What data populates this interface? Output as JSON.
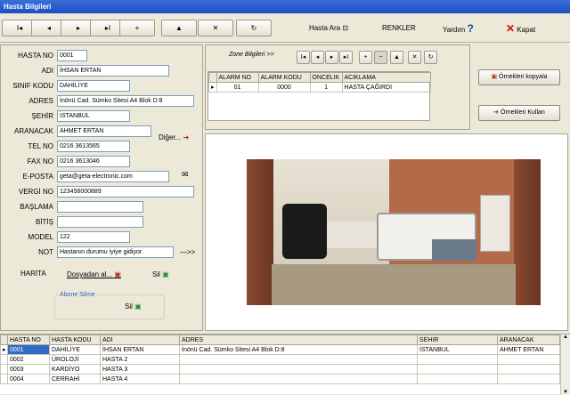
{
  "window": {
    "title": "Hasta Bilgileri"
  },
  "nav": {
    "first": "I◂",
    "prev": "◂",
    "next": "▸",
    "last": "▸I",
    "add": "+",
    "up": "▲",
    "delete": "✕",
    "refresh": "↻"
  },
  "toolbar": {
    "hasta_ara": "Hasta Ara",
    "renkler": "RENKLER",
    "yardim": "Yardım",
    "kapat": "Kapat"
  },
  "form": {
    "labels": {
      "hasta_no": "HASTA NO",
      "adi": "ADI",
      "sinif": "SINIF KODU",
      "adres": "ADRES",
      "sehir": "ŞEHİR",
      "aranacak": "ARANACAK",
      "tel": "TEL NO",
      "fax": "FAX NO",
      "eposta": "E-POSTA",
      "vergi": "VERGİ NO",
      "baslama": "BAŞLAMA",
      "bitis": "BİTİŞ",
      "model": "MODEL",
      "not": "NOT"
    },
    "values": {
      "hasta_no": "0001",
      "adi": "İHSAN ERTAN",
      "sinif": "DAHİLİYE",
      "adres": "İnönü Cad. Sümko Sitesi A4 Blok D:8",
      "sehir": "İSTANBUL",
      "aranacak": "AHMET ERTAN",
      "tel": "0216 3613565",
      "fax": "0216 3613046",
      "eposta": "geta@geta-electronic.com",
      "vergi": "123456000889",
      "baslama": "",
      "bitis": "",
      "model": "122",
      "not": "Hastanın durumu iyiye gidiyor."
    },
    "diger": "Diğer...",
    "not_arrow": "—>>",
    "harita": "HARİTA",
    "dosyadan": "Dosyadan al...",
    "sil": "Sil",
    "abone_title": "Abone Silme",
    "abone_sil": "Sil"
  },
  "zone": {
    "title": "Zone Bilgileri >>",
    "columns": [
      "ALARM NO",
      "ALARM KODU",
      "ONCELIK",
      "ACIKLAMA"
    ],
    "rows": [
      [
        "01",
        "0000",
        "1",
        "HASTA ÇAĞIRDI"
      ]
    ]
  },
  "side": {
    "kopyala": "Örnekleri kopyala",
    "kullan": "Örnekleri Kullan"
  },
  "grid": {
    "columns": [
      "HASTA NO",
      "HASTA KODU",
      "ADI",
      "ADRES",
      "SEHIR",
      "ARANACAK"
    ],
    "rows": [
      [
        "0001",
        "DAHİLİYE",
        "İHSAN ERTAN",
        "İnönü Cad. Sümko Sitesi A4 Blok D:8",
        "İSTANBUL",
        "AHMET ERTAN"
      ],
      [
        "0002",
        "ÜROLOJİ",
        "HASTA 2",
        "",
        "",
        ""
      ],
      [
        "0003",
        "KARDİYO",
        "HASTA 3",
        "",
        "",
        ""
      ],
      [
        "0004",
        "CERRAHİ",
        "HASTA 4",
        "",
        "",
        ""
      ]
    ]
  }
}
